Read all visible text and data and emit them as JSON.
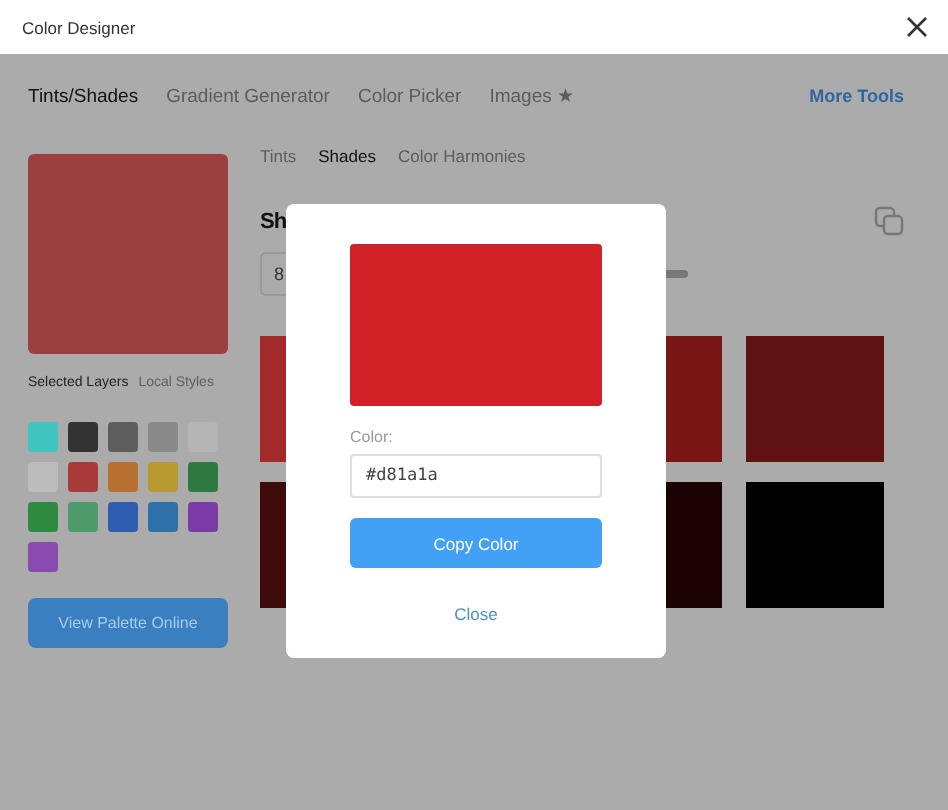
{
  "window": {
    "title": "Color Designer"
  },
  "tabs": [
    {
      "label": "Tints/Shades",
      "selected": true
    },
    {
      "label": "Gradient Generator",
      "selected": false
    },
    {
      "label": "Color Picker",
      "selected": false
    },
    {
      "label": "Images ★",
      "selected": false
    }
  ],
  "more_tools": "More Tools",
  "preview": {
    "color": "#9c3f3f"
  },
  "layer_tabs": [
    {
      "label": "Selected Layers",
      "selected": true
    },
    {
      "label": "Local Styles",
      "selected": false
    }
  ],
  "swatches": [
    {
      "color": "#3fc4bf"
    },
    {
      "color": "#333333"
    },
    {
      "color": "#5e5e5e"
    },
    {
      "color": "#8a8a8a"
    },
    {
      "color": "#b5b5b5"
    },
    {
      "color": "#bcbcbc"
    },
    {
      "color": "#a83a3a"
    },
    {
      "color": "#b87030"
    },
    {
      "color": "#b89a30"
    },
    {
      "color": "#2e7a3e"
    },
    {
      "color": "#2e8a3e"
    },
    {
      "color": "#4f9a6a"
    },
    {
      "color": "#2e5cb0"
    },
    {
      "color": "#2e70a8"
    },
    {
      "color": "#7a3aa8"
    },
    {
      "color": "#8a4ab0"
    }
  ],
  "view_button": "View Palette Online",
  "sub_tabs": [
    {
      "label": "Tints",
      "selected": false
    },
    {
      "label": "Shades",
      "selected": true
    },
    {
      "label": "Color Harmonies",
      "selected": false
    }
  ],
  "heading": "Sh",
  "steps_value": "8",
  "shades": [
    {
      "color": "#a32a2a"
    },
    {
      "color": "#7b1616"
    },
    {
      "color": "#5f1212"
    },
    {
      "color": "#3f0a0a"
    },
    {
      "color": "#1c0303"
    },
    {
      "color": "#000000"
    }
  ],
  "dialog": {
    "color": "#d02126",
    "label": "Color:",
    "value": "#d81a1a",
    "copy_button": "Copy Color",
    "close_link": "Close"
  }
}
